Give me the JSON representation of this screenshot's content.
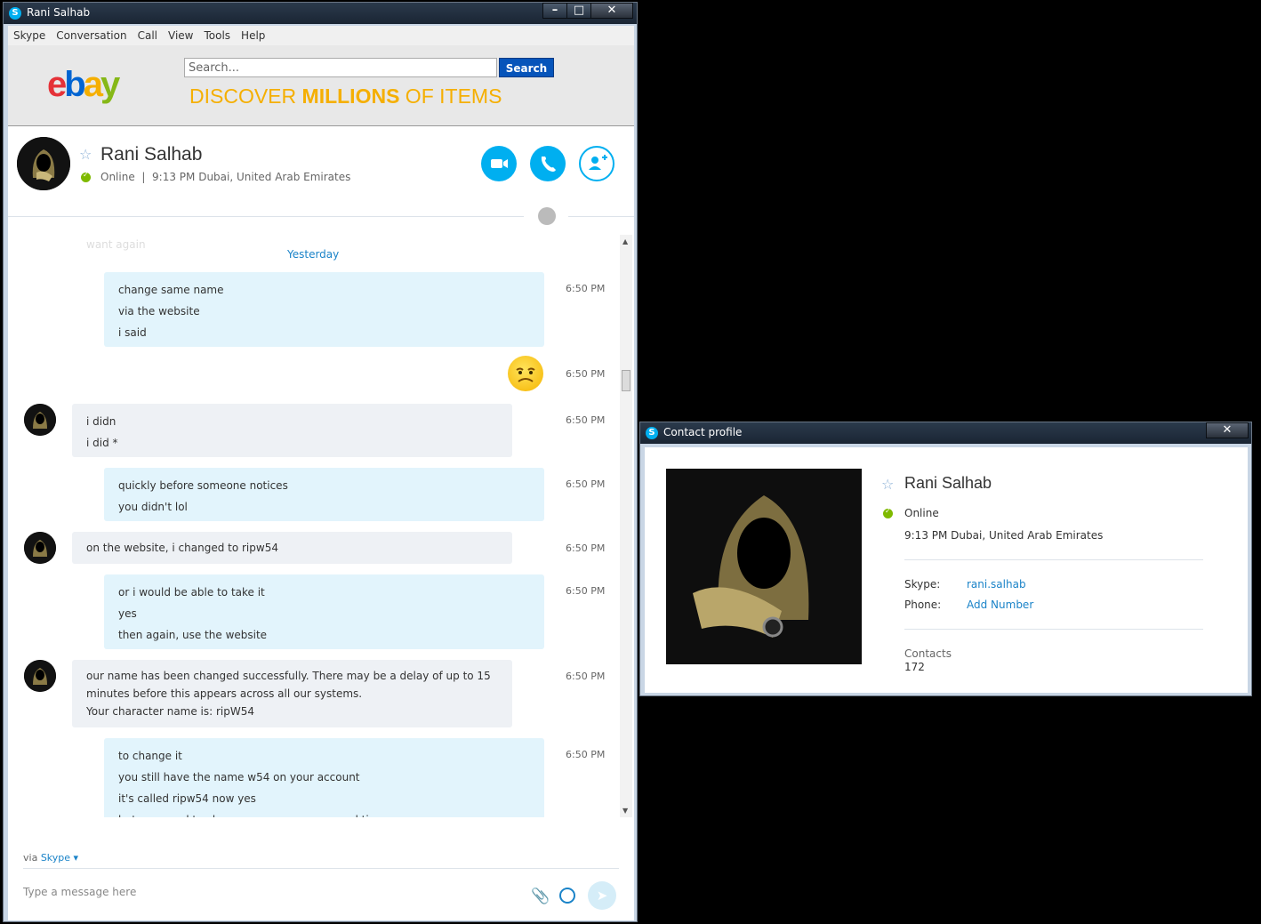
{
  "window": {
    "title": "Rani Salhab"
  },
  "menu": [
    "Skype",
    "Conversation",
    "Call",
    "View",
    "Tools",
    "Help"
  ],
  "ad": {
    "search_placeholder": "Search...",
    "search_button": "Search",
    "slogan_1": "DISCOVER ",
    "slogan_2": "MILLIONS",
    "slogan_3": " OF ITEMS",
    "brand": [
      "e",
      "b",
      "a",
      "y"
    ]
  },
  "contact": {
    "name": "Rani Salhab",
    "status": "Online",
    "location": "9:13 PM Dubai, United Arab Emirates"
  },
  "chat": {
    "faded_prev": "want again",
    "day_label": "Yesterday",
    "messages": [
      {
        "dir": "out",
        "time": "6:50 PM",
        "lines": [
          "change same name",
          "via the website",
          "i said"
        ]
      },
      {
        "dir": "out",
        "time": "6:50 PM",
        "emoticon": "worried-emoticon"
      },
      {
        "dir": "in",
        "time": "6:50 PM",
        "lines": [
          "i didn",
          "i did *"
        ]
      },
      {
        "dir": "out",
        "time": "6:50 PM",
        "lines": [
          "quickly before someone notices",
          "you didn't lol"
        ]
      },
      {
        "dir": "in",
        "time": "6:50 PM",
        "lines": [
          "on the website, i changed to ripw54"
        ]
      },
      {
        "dir": "out",
        "time": "6:50 PM",
        "lines": [
          "or i would be able to take it",
          "yes",
          "then again, use the website"
        ]
      },
      {
        "dir": "in",
        "time": "6:50 PM",
        "lines": [
          "our name has been changed successfully. There may be a delay of up to 15",
          "minutes before this appears across all our systems.",
          "Your character name is: ripW54"
        ]
      },
      {
        "dir": "out",
        "time": "6:50 PM",
        "lines": [
          "to change it",
          "you still have the name w54 on your account",
          "it's called ripw54 now yes",
          "but you need to change your name a second time"
        ]
      }
    ]
  },
  "composer": {
    "via_label": "via ",
    "via_service": "Skype",
    "placeholder": "Type a message here"
  },
  "profile": {
    "title": "Contact profile",
    "name": "Rani Salhab",
    "status": "Online",
    "location": "9:13 PM Dubai, United Arab Emirates",
    "skype_label": "Skype:",
    "skype_value": "rani.salhab",
    "phone_label": "Phone:",
    "phone_value": "Add Number",
    "contacts_label": "Contacts",
    "contacts_value": "172"
  },
  "colors": {
    "accent": "#00aff0",
    "link": "#1a83c8",
    "online": "#7fba00",
    "outgoing": "#e2f4fc",
    "incoming": "#eef1f5"
  }
}
